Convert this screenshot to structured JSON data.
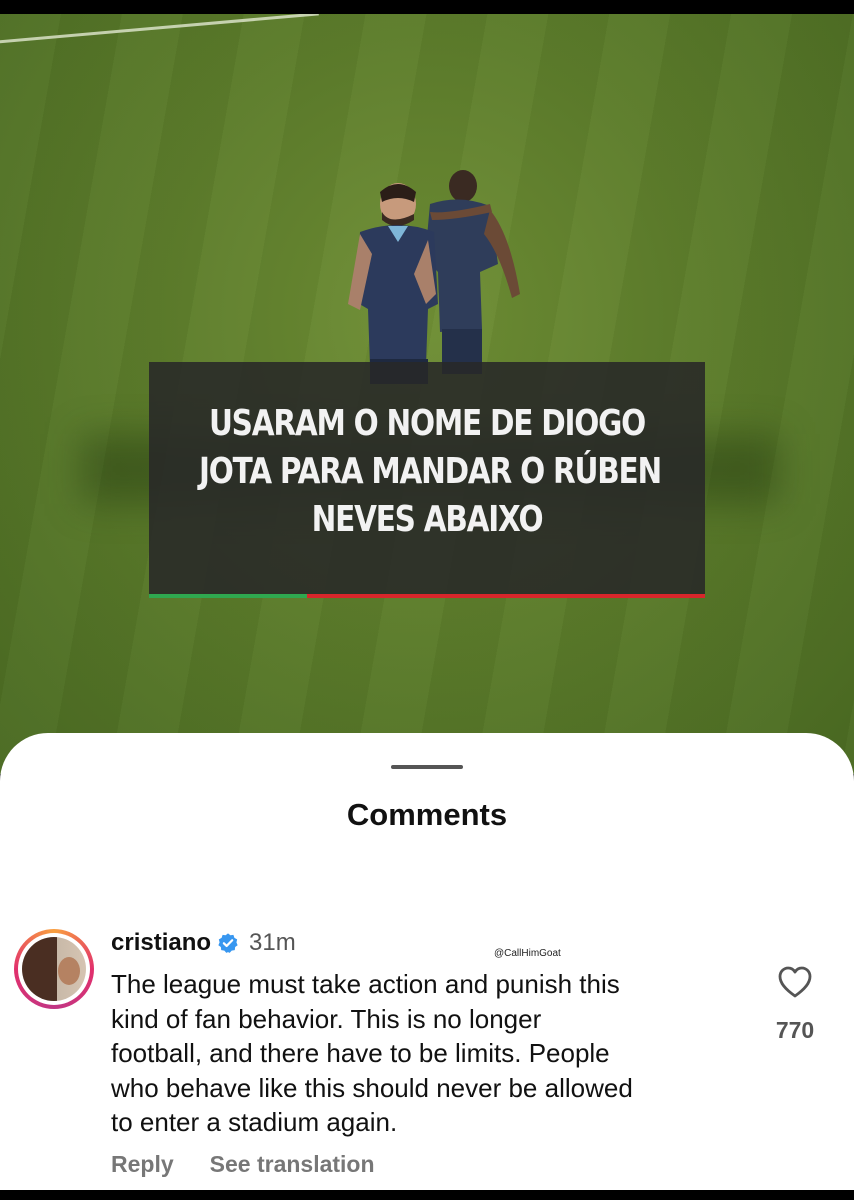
{
  "video": {
    "overlay_lines": [
      "USARAM O NOME DE DIOGO",
      "JOTA PARA MANDAR O RÚBEN",
      "NEVES ABAIXO"
    ],
    "accent_colors": {
      "green": "#2fa84f",
      "red": "#d8262b"
    }
  },
  "sheet": {
    "title": "Comments"
  },
  "comment": {
    "username": "cristiano",
    "verified_icon": "verified-badge-icon",
    "time": "31m",
    "watermark": "@CallHimGoat",
    "text_lines": [
      "The league must take action and punish this",
      "kind of fan behavior. This is no longer",
      "football, and there have to be limits. People",
      "who behave like this should never be allowed",
      "to enter a stadium again."
    ],
    "like_icon": "heart-icon",
    "like_count": "770",
    "reply_label": "Reply",
    "translate_label": "See translation"
  }
}
